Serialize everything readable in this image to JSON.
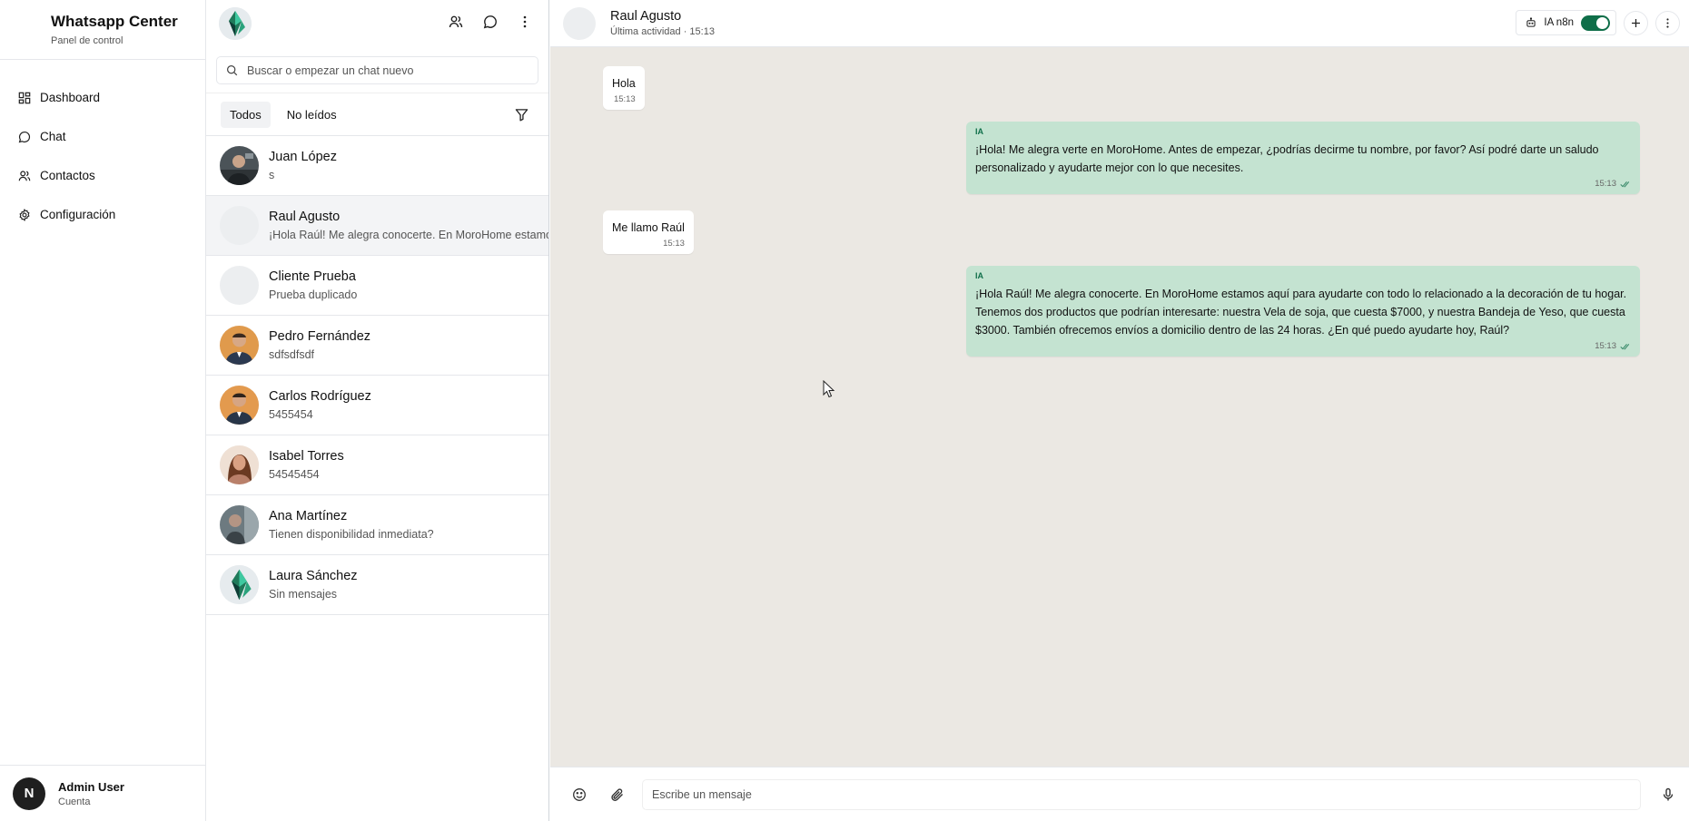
{
  "nav": {
    "brand_title": "Whatsapp Center",
    "brand_subtitle": "Panel de control",
    "items": [
      {
        "label": "Dashboard",
        "icon": "dashboard-icon"
      },
      {
        "label": "Chat",
        "icon": "chat-bubble-icon"
      },
      {
        "label": "Contactos",
        "icon": "users-icon"
      },
      {
        "label": "Configuración",
        "icon": "gear-icon"
      }
    ],
    "user": {
      "initial": "N",
      "name": "Admin User",
      "subtitle": "Cuenta"
    }
  },
  "chat_list": {
    "search_placeholder": "Buscar o empezar un chat nuevo",
    "filters": [
      {
        "label": "Todos",
        "active": true
      },
      {
        "label": "No leídos",
        "active": false
      }
    ],
    "chats": [
      {
        "name": "Juan López",
        "preview": "s",
        "avatar": "photo"
      },
      {
        "name": "Raul Agusto",
        "preview": "¡Hola Raúl! Me alegra conocerte. En MoroHome estamos aquí para ayudarte con todo lo relacionado",
        "avatar": "placeholder",
        "selected": true
      },
      {
        "name": "Cliente Prueba",
        "preview": "Prueba duplicado",
        "avatar": "placeholder"
      },
      {
        "name": "Pedro Fernández",
        "preview": "sdfsdfsdf",
        "avatar": "photo"
      },
      {
        "name": "Carlos Rodríguez",
        "preview": "5455454",
        "avatar": "photo"
      },
      {
        "name": "Isabel Torres",
        "preview": "54545454",
        "avatar": "photo"
      },
      {
        "name": "Ana Martínez",
        "preview": "Tienen disponibilidad inmediata?",
        "avatar": "photo"
      },
      {
        "name": "Laura Sánchez",
        "preview": "Sin mensajes",
        "avatar": "logo"
      }
    ]
  },
  "conversation": {
    "contact_name": "Raul Agusto",
    "status": "Última actividad · 15:13",
    "ia_label": "IA n8n",
    "ia_enabled": true,
    "messages": [
      {
        "direction": "in",
        "text": "Hola",
        "time": "15:13"
      },
      {
        "direction": "out",
        "tag": "IA",
        "text": "¡Hola! Me alegra verte en MoroHome. Antes de empezar, ¿podrías decirme tu nombre, por favor? Así podré darte un saludo personalizado y ayudarte mejor con lo que necesites.",
        "time": "15:13"
      },
      {
        "direction": "in",
        "text": "Me llamo Raúl",
        "time": "15:13"
      },
      {
        "direction": "out",
        "tag": "IA",
        "text": "¡Hola Raúl! Me alegra conocerte. En MoroHome estamos aquí para ayudarte con todo lo relacionado a la decoración de tu hogar. Tenemos dos productos que podrían interesarte: nuestra Vela de soja, que cuesta $7000, y nuestra Bandeja de Yeso, que cuesta $3000. También ofrecemos envíos a domicilio dentro de las 24 horas. ¿En qué puedo ayudarte hoy, Raúl?",
        "time": "15:13"
      }
    ],
    "composer_placeholder": "Escribe un mensaje"
  },
  "colors": {
    "accent": "#0f6e49",
    "outgoing_bubble": "#c4e3d1",
    "chat_background": "#ebe8e3"
  }
}
